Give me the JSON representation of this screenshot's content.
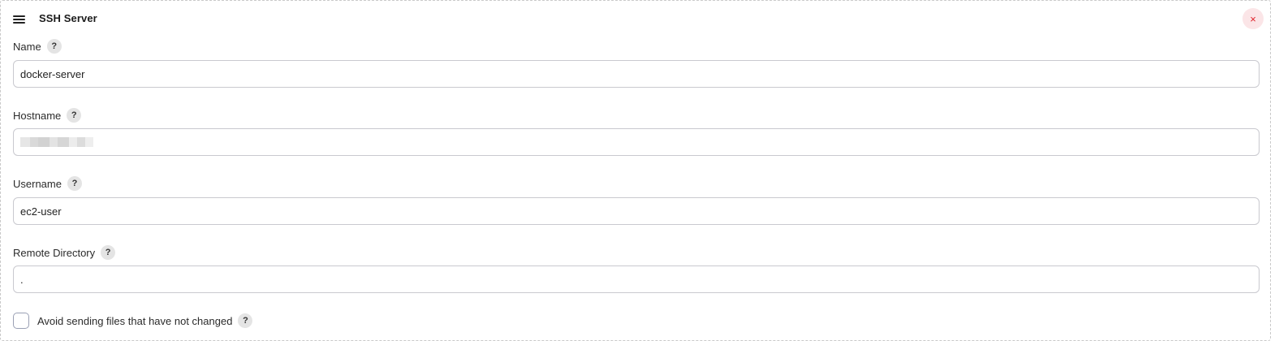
{
  "panel": {
    "title": "SSH Server",
    "close_symbol": "×",
    "icons": {
      "drag": "hamburger-icon",
      "close": "close-icon",
      "help": "help-icon"
    },
    "colors": {
      "close_bg": "#fbe5e7",
      "close_fg": "#e0222b",
      "border": "#c8c8c8"
    }
  },
  "fields": {
    "name": {
      "label": "Name",
      "help": "?",
      "value": "docker-server"
    },
    "hostname": {
      "label": "Hostname",
      "help": "?",
      "value": ""
    },
    "username": {
      "label": "Username",
      "help": "?",
      "value": "ec2-user"
    },
    "remote_directory": {
      "label": "Remote Directory",
      "help": "?",
      "value": "."
    }
  },
  "options": {
    "avoid_sending": {
      "label": "Avoid sending files that have not changed",
      "help": "?",
      "checked": false
    }
  }
}
